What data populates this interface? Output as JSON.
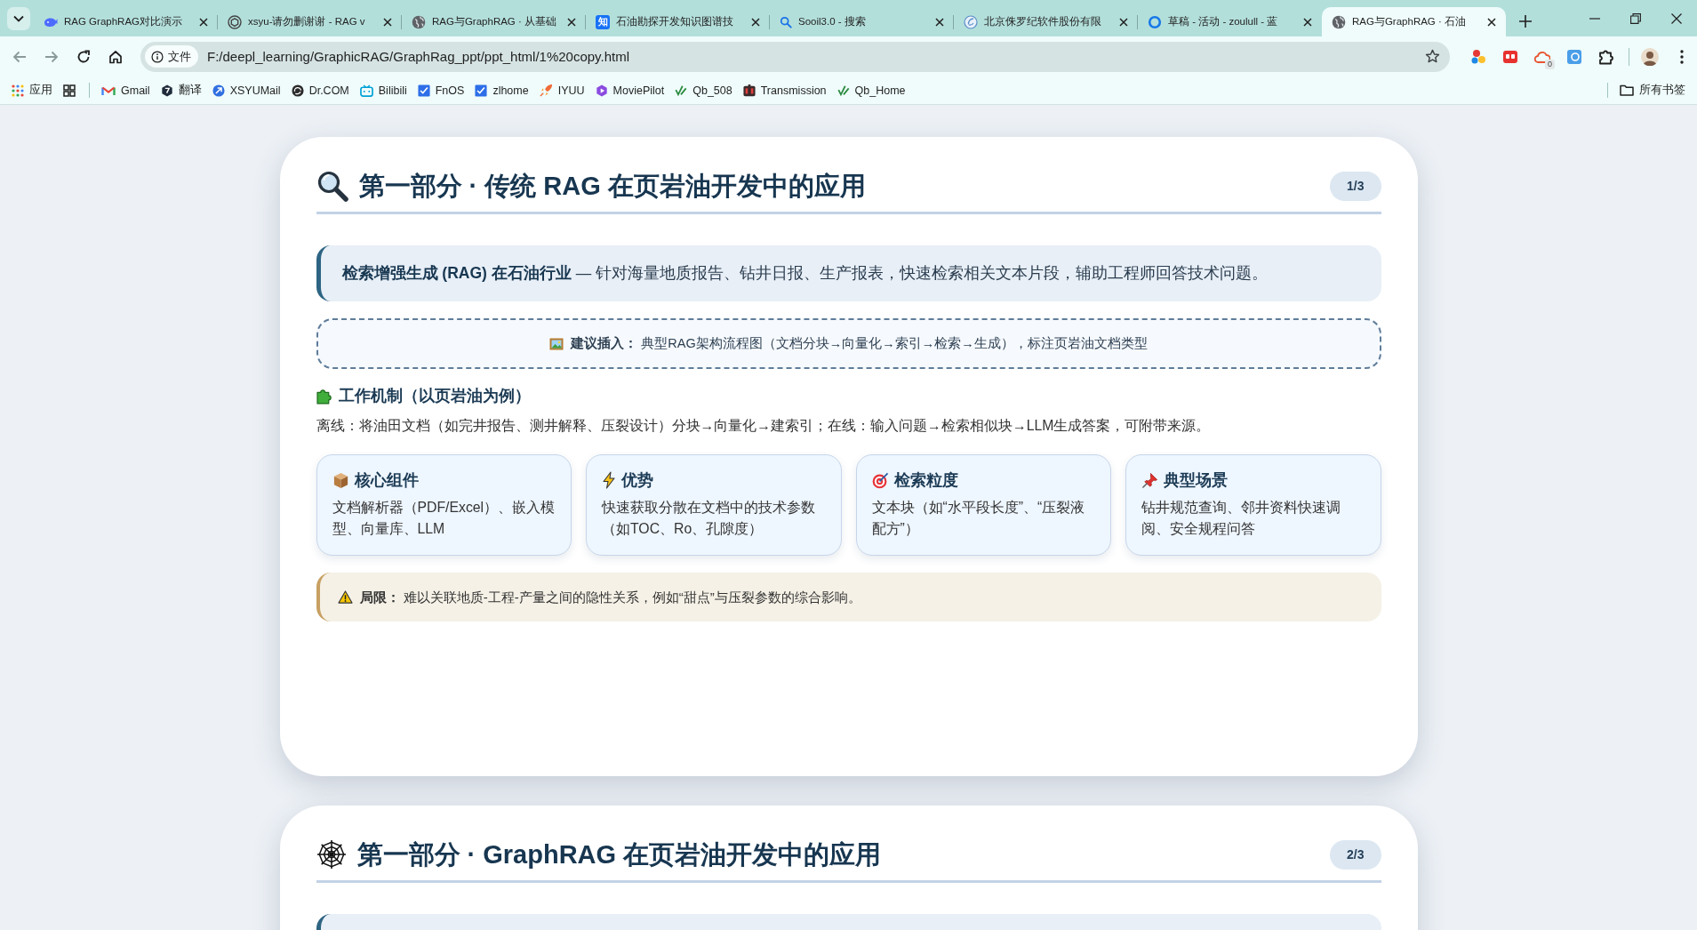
{
  "tabs": [
    {
      "title": "RAG GraphRAG对比演示",
      "selected": false
    },
    {
      "title": "xsyu-请勿删谢谢 - RAG v",
      "selected": false
    },
    {
      "title": "RAG与GraphRAG · 从基础",
      "selected": false
    },
    {
      "title": "石油勘探开发知识图谱技",
      "icon_text": "知",
      "selected": false
    },
    {
      "title": "Sooil3.0 - 搜索",
      "selected": false
    },
    {
      "title": "北京侏罗纪软件股份有限",
      "selected": false
    },
    {
      "title": "草稿 - 活动 - zoulull - 蓝",
      "selected": false
    },
    {
      "title": "RAG与GraphRAG · 石油",
      "selected": true
    }
  ],
  "address_bar": {
    "chip": "文件",
    "url": "F:/deepl_learning/GraphicRAG/GraphRag_ppt/ppt_html/1%20copy.html"
  },
  "extensions": {
    "badge": "0"
  },
  "bookmarks_bar": {
    "apps": "应用",
    "items": [
      "Gmail",
      "翻译",
      "XSYUMail",
      "Dr.COM",
      "Bilibili",
      "FnOS",
      "zlhome",
      "IYUU",
      "MoviePilot",
      "Qb_508",
      "Transmission",
      "Qb_Home"
    ],
    "all_bookmarks": "所有书签"
  },
  "slides": [
    {
      "title": "第一部分 · 传统 RAG 在页岩油开发中的应用",
      "page": "1/3",
      "intro": "**检索增强生成 (RAG) 在石油行业** — 针对海量地质报告、钻井日报、生产报表，快速检索相关文本片段，辅助工程师回答技术问题。",
      "suggestion": "**建议插入：** 典型RAG架构流程图（文档分块→向量化→索引→检索→生成），标注页岩油文档类型",
      "section_heading": "工作机制（以页岩油为例）",
      "section_text": "离线：将油田文档（如完井报告、测井解释、压裂设计）分块→向量化→建索引；在线：输入问题→检索相似块→LLM生成答案，可附带来源。",
      "cards": [
        {
          "title": "核心组件",
          "text": "文档解析器（PDF/Excel）、嵌入模型、向量库、LLM"
        },
        {
          "title": "优势",
          "text": "快速获取分散在文档中的技术参数（如TOC、Ro、孔隙度）"
        },
        {
          "title": "检索粒度",
          "text": "文本块（如“水平段长度”、“压裂液配方”）"
        },
        {
          "title": "典型场景",
          "text": "钻井规范查询、邻井资料快速调阅、安全规程问答"
        }
      ],
      "limitation": "**局限：** 难以关联地质-工程-产量之间的隐性关系，例如“甜点”与压裂参数的综合影响。"
    },
    {
      "title": "第一部分 · GraphRAG 在页岩油开发中的应用",
      "page": "2/3"
    }
  ]
}
